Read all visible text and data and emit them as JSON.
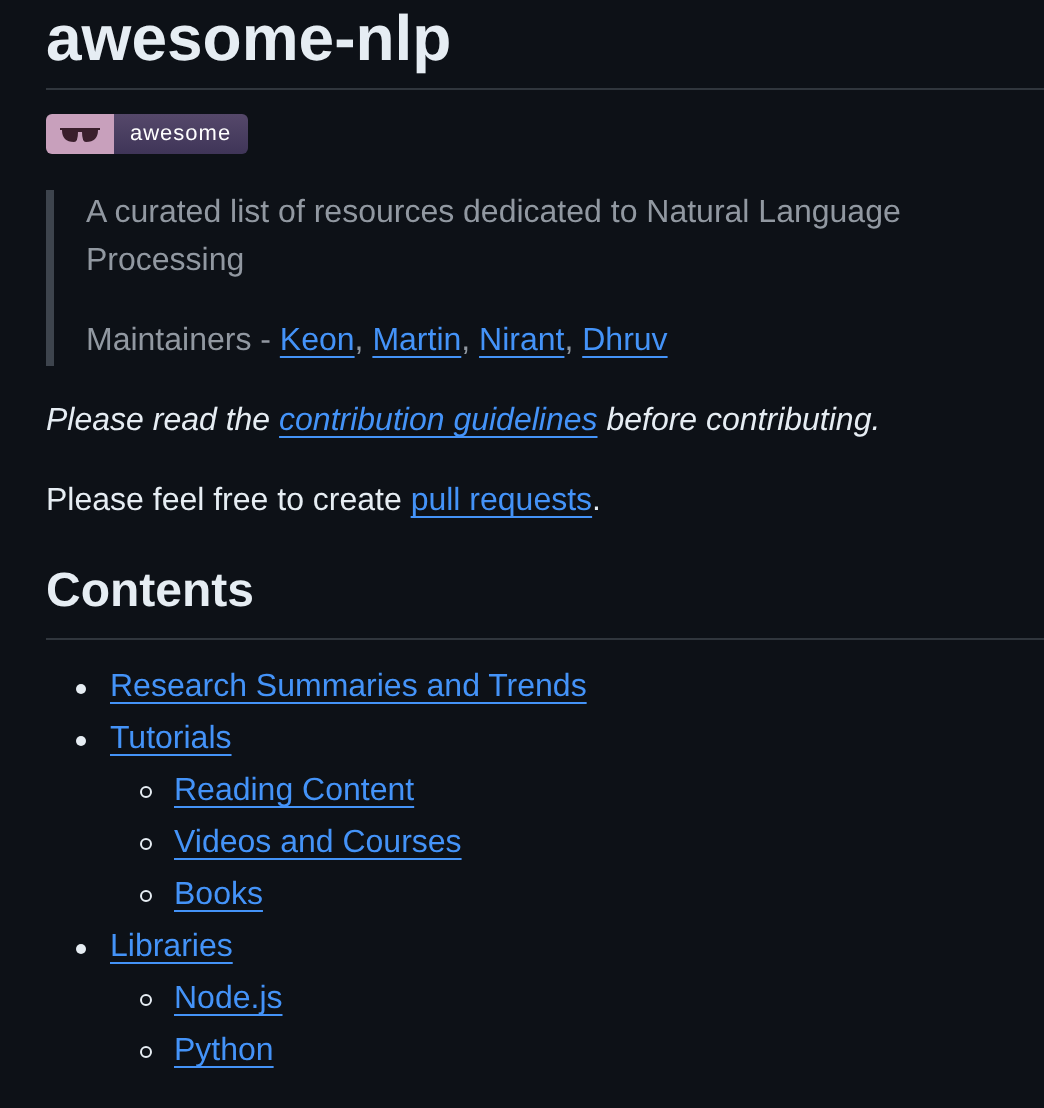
{
  "title": "awesome-nlp",
  "badge": {
    "label": "awesome"
  },
  "blockquote": {
    "description": "A curated list of resources dedicated to Natural Language Processing",
    "maintainers_prefix": "Maintainers - ",
    "separator": ", ",
    "maintainers": [
      "Keon",
      "Martin",
      "Nirant",
      "Dhruv"
    ]
  },
  "notes": [
    {
      "italic": true,
      "before": "Please read the ",
      "link": "contribution guidelines",
      "after": " before contributing."
    },
    {
      "italic": false,
      "before": "Please feel free to create ",
      "link": "pull requests",
      "after": "."
    }
  ],
  "contents": {
    "heading": "Contents",
    "items": [
      {
        "label": "Research Summaries and Trends"
      },
      {
        "label": "Tutorials",
        "children": [
          {
            "label": "Reading Content"
          },
          {
            "label": "Videos and Courses"
          },
          {
            "label": "Books"
          }
        ]
      },
      {
        "label": "Libraries",
        "children": [
          {
            "label": "Node.js"
          },
          {
            "label": "Python"
          }
        ]
      }
    ]
  }
}
